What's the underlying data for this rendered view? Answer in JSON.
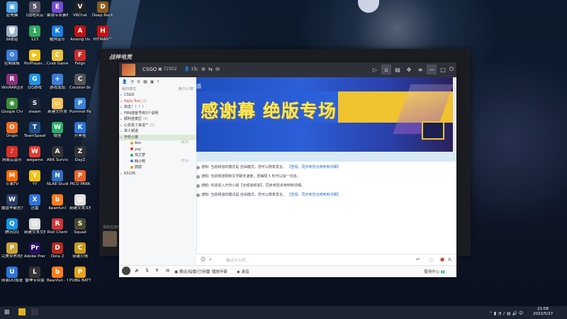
{
  "desktop": {
    "icons": [
      {
        "label": "此电脑",
        "color": "#4aa3df",
        "glyph": "▣"
      },
      {
        "label": "回收站",
        "color": "#9ab0c6",
        "glyph": "🗑"
      },
      {
        "label": "控制面板",
        "color": "#3b7dd8",
        "glyph": "⚙"
      },
      {
        "label": "WinRAR压缩",
        "color": "#8a2f7a",
        "glyph": "R"
      },
      {
        "label": "Google Chrome",
        "color": "#3b8c3b",
        "glyph": "◉"
      },
      {
        "label": "Origin",
        "color": "#f06b1d",
        "glyph": "O"
      },
      {
        "label": "网易云音乐",
        "color": "#d93025",
        "glyph": "♪"
      },
      {
        "label": "芒果TV",
        "color": "#ff6a00",
        "glyph": "M"
      },
      {
        "label": "魔兽争霸官方对战平台",
        "color": "#2a3f66",
        "glyph": "W"
      },
      {
        "label": "腾讯QQ",
        "color": "#1a94e6",
        "glyph": "Q"
      },
      {
        "label": "完美世界竞技平台",
        "color": "#c8a33b",
        "glyph": "P"
      },
      {
        "label": "网易UU加速器",
        "color": "#2a74d8",
        "glyph": "U"
      },
      {
        "label": "《战地风云 5》",
        "color": "#556",
        "glyph": "5"
      },
      {
        "label": "123",
        "color": "#2fa85f",
        "glyph": "1"
      },
      {
        "label": "PotPlayer...",
        "color": "#f2c21b",
        "glyph": "▶"
      },
      {
        "label": "QQ游戏",
        "color": "#1a94e6",
        "glyph": "G"
      },
      {
        "label": "steam",
        "color": "#1b2838",
        "glyph": "S"
      },
      {
        "label": "TeamSpeak 3",
        "color": "#1d4e86",
        "glyph": "T"
      },
      {
        "label": "wegame",
        "color": "#e23b2e",
        "glyph": "W"
      },
      {
        "label": "YY",
        "color": "#f2c21b",
        "glyph": "Y"
      },
      {
        "label": "迅雷",
        "color": "#2a74d8",
        "glyph": "X"
      },
      {
        "label": "新建文本文档",
        "color": "#ddd",
        "glyph": "▤"
      },
      {
        "label": "Adobe Premie...",
        "color": "#2a0f5e",
        "glyph": "Pr"
      },
      {
        "label": "雷神专业版",
        "color": "#333",
        "glyph": "L"
      },
      {
        "label": "乘境专业素材",
        "color": "#7a4bd0",
        "glyph": "E"
      },
      {
        "label": "酷狗音乐",
        "color": "#1a7fe6",
        "glyph": "K"
      },
      {
        "label": "Crab Game",
        "color": "#e8c23c",
        "glyph": "C"
      },
      {
        "label": "游戏加加",
        "color": "#3b7dd8",
        "glyph": "+"
      },
      {
        "label": "新建文件夹",
        "color": "#f2c45c",
        "glyph": "▭"
      },
      {
        "label": "微信",
        "color": "#2aae67",
        "glyph": "W"
      },
      {
        "label": "ARK Survival Evolved",
        "color": "#333",
        "glyph": "A"
      },
      {
        "label": "NLAE-Studio 快捷方式",
        "color": "#2f6fbf",
        "glyph": "N"
      },
      {
        "label": "beanfun!",
        "color": "#ff7a1a",
        "glyph": "b"
      },
      {
        "label": "Riot Client",
        "color": "#d13639",
        "glyph": "R"
      },
      {
        "label": "Dota 2",
        "color": "#b32b1b",
        "glyph": "D"
      },
      {
        "label": "Beanfun - 快捷方式",
        "color": "#ff7a1a",
        "glyph": "b"
      },
      {
        "label": "VRChat",
        "color": "#222",
        "glyph": "V"
      },
      {
        "label": "Among Us",
        "color": "#c51111",
        "glyph": "A"
      },
      {
        "label": "Feign",
        "color": "#cc2b2b",
        "glyph": "F"
      },
      {
        "label": "Counter-Strike Source",
        "color": "#555",
        "glyph": "C"
      },
      {
        "label": "Pummel Party",
        "color": "#3a82d6",
        "glyph": "P"
      },
      {
        "label": "开黑啦",
        "color": "#2a74d8",
        "glyph": "K"
      },
      {
        "label": "DayZ",
        "color": "#333",
        "glyph": "Z"
      },
      {
        "label": "PICO PARK",
        "color": "#e8632c",
        "glyph": "P"
      },
      {
        "label": "新建文本文档 (2)",
        "color": "#ddd",
        "glyph": "▤"
      },
      {
        "label": "Squad",
        "color": "#4a4a2e",
        "glyph": "S"
      },
      {
        "label": "穿越火线",
        "color": "#c89a1b",
        "glyph": "C"
      },
      {
        "label": "PUBG BATTLEGR...",
        "color": "#e6a21b",
        "glyph": "P"
      },
      {
        "label": "Deep Rock Galactic",
        "color": "#8a5a1b",
        "glyph": "D"
      },
      {
        "label": "HITMAN™",
        "color": "#c51111",
        "glyph": "H"
      }
    ]
  },
  "dark_app": {
    "logo": "战神电竞",
    "side_text": "保存在游戏中"
  },
  "app": {
    "title": "CSGO",
    "room_id": "72502",
    "user_count": "15"
  },
  "left_panel": {
    "header_left": "我的模式",
    "header_right": "用户/人数",
    "channels": [
      {
        "label": "CSGO",
        "arrow": "▸",
        "style": "normal",
        "count": ""
      },
      {
        "label": "Rajio Tool",
        "arrow": "▸",
        "style": "red",
        "count": "(1)"
      },
      {
        "label": "双击！！！！",
        "arrow": "▸",
        "style": "normal",
        "count": ""
      },
      {
        "label": "FBN游客号到3个说明",
        "arrow": "▸",
        "style": "normal",
        "count": ""
      },
      {
        "label": "顺利连麦区",
        "arrow": "▸",
        "style": "normal",
        "count": "(4)"
      },
      {
        "label": "心花看了来说\"\"",
        "arrow": "▸",
        "style": "normal",
        "count": "(1)"
      },
      {
        "label": "单人频道",
        "arrow": "▸",
        "style": "normal",
        "count": ""
      },
      {
        "label": "疗伤小歌",
        "arrow": "▾",
        "style": "highlight",
        "count": ""
      },
      {
        "label": "Azo",
        "arrow": "",
        "style": "sub",
        "count": "",
        "tag": "(离开)"
      },
      {
        "label": "yoy",
        "arrow": "",
        "style": "sub",
        "count": ""
      },
      {
        "label": "快之梦",
        "arrow": "",
        "style": "sub",
        "count": ""
      },
      {
        "label": "韩小明",
        "arrow": "",
        "style": "sub",
        "count": "",
        "tag": "(无法)"
      },
      {
        "label": "鸽鸽",
        "arrow": "",
        "style": "sub",
        "count": ""
      },
      {
        "label": "63136",
        "arrow": "▸",
        "style": "normal",
        "count": ""
      }
    ]
  },
  "banner": {
    "top_text": "感",
    "big_text": "感谢幕 绝版专场"
  },
  "messages": [
    {
      "prefix": "通知:",
      "text": "当前频道的模式是 自由模式，您可以随意发言。",
      "link": "【查看，同步到您点用到到详细】"
    },
    {
      "prefix": "通知:",
      "text": "当前频道限制文字聊天速度，您每隔 5 秒可以说一句话。",
      "link": ""
    },
    {
      "prefix": "通知:",
      "text": "欢迎进入疗伤小歌【全频道频道】，同步到您点用到到详细。",
      "link": ""
    },
    {
      "prefix": "通知:",
      "text": "当前频道的模式是 自由模式，您可以随意发言。",
      "link": "【查看，同步到您点用到到详细】"
    }
  ],
  "input": {
    "placeholder": "输点什么吧..."
  },
  "bottom_bar": {
    "record_label": "搬运/指播/已待播",
    "music_label": "播放伴奏",
    "record2_label": "录音",
    "status_label": "使用中心"
  },
  "taskbar": {
    "time": "21:08",
    "date": "2022/5/27"
  }
}
